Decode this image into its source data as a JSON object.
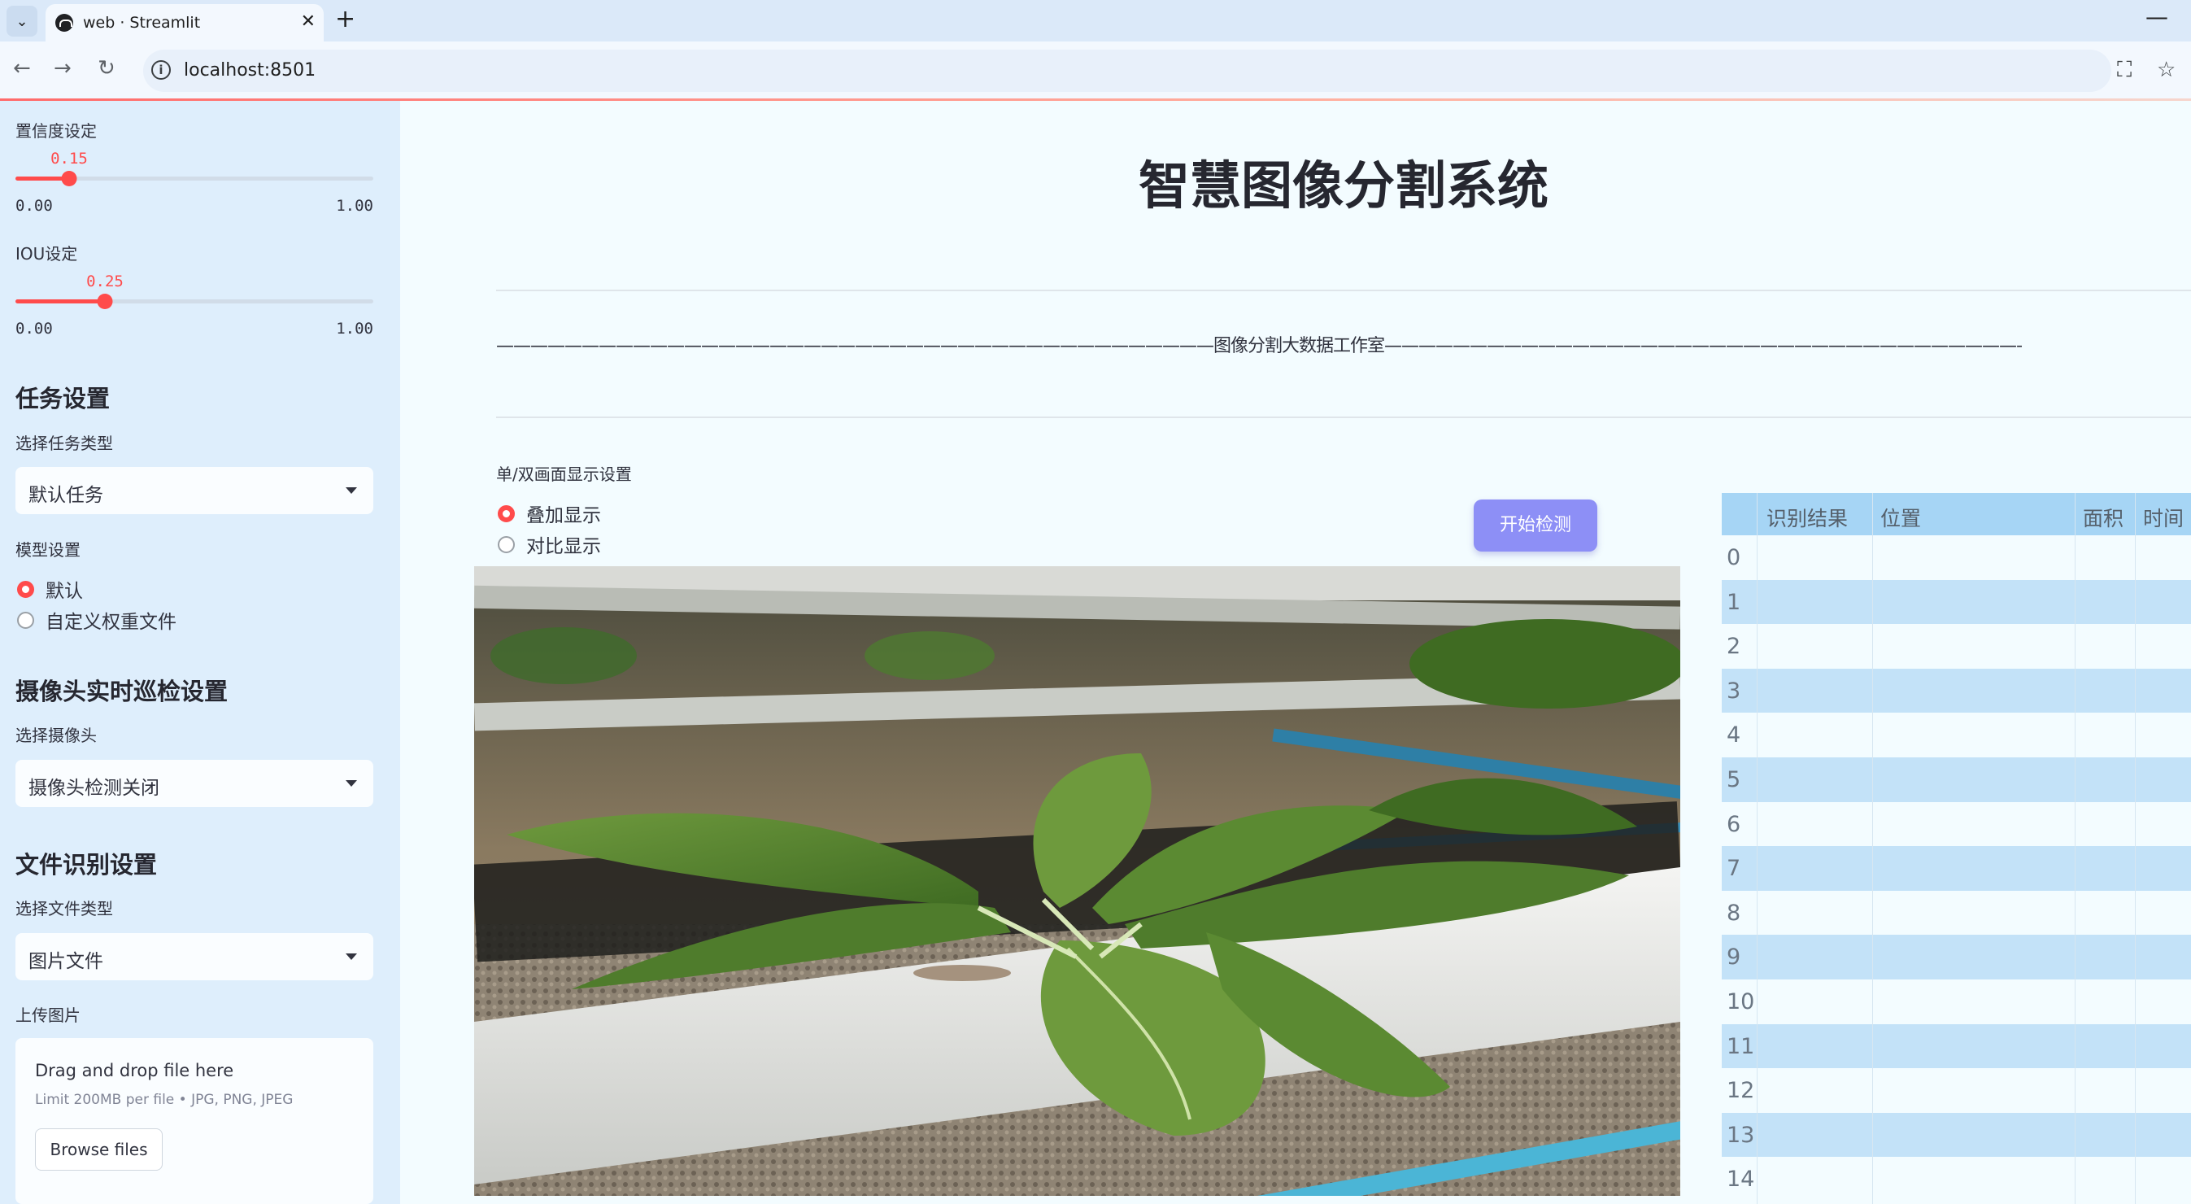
{
  "browser": {
    "tab_title": "web · Streamlit",
    "url": "localhost:8501"
  },
  "sidebar": {
    "confidence": {
      "label": "置信度设定",
      "value": "0.15",
      "value_num": 0.15,
      "min": "0.00",
      "max": "1.00"
    },
    "iou": {
      "label": "IOU设定",
      "value": "0.25",
      "value_num": 0.25,
      "min": "0.00",
      "max": "1.00"
    },
    "task_section": "任务设置",
    "task_type_label": "选择任务类型",
    "task_type_value": "默认任务",
    "model_label": "模型设置",
    "model_options": [
      "默认",
      "自定义权重文件"
    ],
    "model_selected": 0,
    "camera_section": "摄像头实时巡检设置",
    "camera_label": "选择摄像头",
    "camera_value": "摄像头检测关闭",
    "file_section": "文件识别设置",
    "file_type_label": "选择文件类型",
    "file_type_value": "图片文件",
    "upload_label": "上传图片",
    "upload": {
      "drag_text": "Drag and drop file here",
      "limit_text": "Limit 200MB per file • JPG, PNG, JPEG",
      "browse_label": "Browse files"
    }
  },
  "main": {
    "title": "智慧图像分割系统",
    "subtitle": "——————————————————————————————————————————图像分割大数据工作室—————————————————————————————————————————————",
    "display_label": "单/双画面显示设置",
    "display_options": [
      "叠加显示",
      "对比显示"
    ],
    "display_selected": 0,
    "detect_button": "开始检测"
  },
  "table": {
    "headers": [
      "识别结果",
      "位置",
      "面积",
      "时间"
    ],
    "rows": [
      "0",
      "1",
      "2",
      "3",
      "4",
      "5",
      "6",
      "7",
      "8",
      "9",
      "10",
      "11",
      "12",
      "13",
      "14"
    ]
  },
  "colors": {
    "accent": "#ff4b4b",
    "button": "#8d8ff6",
    "sidebar_bg": "#deeefc",
    "table_header": "#a6d5f5",
    "table_alt_row": "#c3e2f8"
  }
}
